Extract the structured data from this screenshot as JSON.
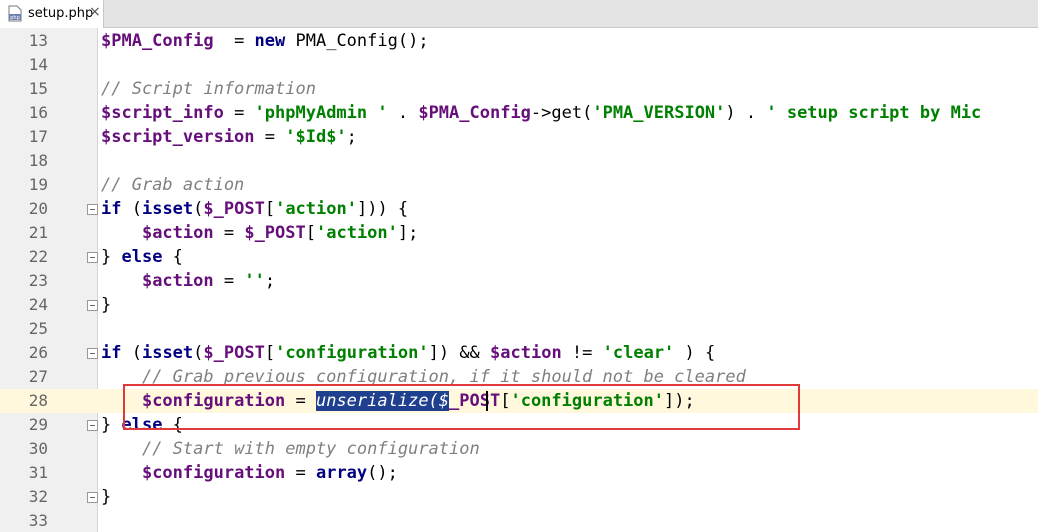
{
  "tab": {
    "filename": "setup.php",
    "close_glyph": "×",
    "icon": "php-file-icon"
  },
  "lines": [
    {
      "n": "13",
      "seg": [
        [
          "var",
          "$PMA_Config"
        ],
        [
          "",
          "  = "
        ],
        [
          "kw",
          "new"
        ],
        [
          "fn",
          " PMA_Config();"
        ]
      ]
    },
    {
      "n": "14",
      "seg": []
    },
    {
      "n": "15",
      "seg": [
        [
          "cmt",
          "// Script information"
        ]
      ]
    },
    {
      "n": "16",
      "seg": [
        [
          "var",
          "$script_info"
        ],
        [
          "",
          " = "
        ],
        [
          "str",
          "'phpMyAdmin '"
        ],
        [
          "",
          " . "
        ],
        [
          "var",
          "$PMA_Config"
        ],
        [
          "",
          "->get("
        ],
        [
          "str",
          "'PMA_VERSION'"
        ],
        [
          "",
          ") . "
        ],
        [
          "str",
          "' setup script by Mic"
        ]
      ]
    },
    {
      "n": "17",
      "seg": [
        [
          "var",
          "$script_version"
        ],
        [
          "",
          " = "
        ],
        [
          "str",
          "'$Id$'"
        ],
        [
          "",
          ";"
        ]
      ]
    },
    {
      "n": "18",
      "seg": []
    },
    {
      "n": "19",
      "seg": [
        [
          "cmt",
          "// Grab action"
        ]
      ]
    },
    {
      "n": "20",
      "seg": [
        [
          "kw",
          "if"
        ],
        [
          "",
          " ("
        ],
        [
          "kw",
          "isset"
        ],
        [
          "",
          "("
        ],
        [
          "var",
          "$_POST"
        ],
        [
          "",
          "["
        ],
        [
          "str",
          "'action'"
        ],
        [
          "",
          "])) {"
        ]
      ]
    },
    {
      "n": "21",
      "seg": [
        [
          "",
          "    "
        ],
        [
          "var",
          "$action"
        ],
        [
          "",
          " = "
        ],
        [
          "var",
          "$_POST"
        ],
        [
          "",
          "["
        ],
        [
          "str",
          "'action'"
        ],
        [
          "",
          "];"
        ]
      ]
    },
    {
      "n": "22",
      "seg": [
        [
          "",
          "} "
        ],
        [
          "kw",
          "else"
        ],
        [
          "",
          " {"
        ]
      ]
    },
    {
      "n": "23",
      "seg": [
        [
          "",
          "    "
        ],
        [
          "var",
          "$action"
        ],
        [
          "",
          " = "
        ],
        [
          "str",
          "''"
        ],
        [
          "",
          ";"
        ]
      ]
    },
    {
      "n": "24",
      "seg": [
        [
          "",
          "}"
        ]
      ]
    },
    {
      "n": "25",
      "seg": []
    },
    {
      "n": "26",
      "seg": [
        [
          "kw",
          "if"
        ],
        [
          "",
          " ("
        ],
        [
          "kw",
          "isset"
        ],
        [
          "",
          "("
        ],
        [
          "var",
          "$_POST"
        ],
        [
          "",
          "["
        ],
        [
          "str",
          "'configuration'"
        ],
        [
          "",
          "]) && "
        ],
        [
          "var",
          "$action"
        ],
        [
          "",
          " != "
        ],
        [
          "str",
          "'clear'"
        ],
        [
          "",
          " ) {"
        ]
      ]
    },
    {
      "n": "27",
      "seg": [
        [
          "",
          "    "
        ],
        [
          "cmt",
          "// Grab previous configuration, if it should not be cleared"
        ]
      ]
    },
    {
      "n": "28",
      "seg": [
        [
          "",
          "    "
        ],
        [
          "var",
          "$configuration"
        ],
        [
          "",
          " = "
        ],
        [
          "sel",
          "unserialize($"
        ],
        [
          "var",
          "_POST"
        ],
        [
          "",
          "["
        ],
        [
          "str",
          "'configuration'"
        ],
        [
          "",
          "]);"
        ]
      ]
    },
    {
      "n": "29",
      "seg": [
        [
          "",
          "} "
        ],
        [
          "kw",
          "else"
        ],
        [
          "",
          " {"
        ]
      ]
    },
    {
      "n": "30",
      "seg": [
        [
          "",
          "    "
        ],
        [
          "cmt",
          "// Start with empty configuration"
        ]
      ]
    },
    {
      "n": "31",
      "seg": [
        [
          "",
          "    "
        ],
        [
          "var",
          "$configuration"
        ],
        [
          "",
          " = "
        ],
        [
          "kw",
          "array"
        ],
        [
          "",
          "();"
        ]
      ]
    },
    {
      "n": "32",
      "seg": [
        [
          "",
          "}"
        ]
      ]
    },
    {
      "n": "33",
      "seg": []
    }
  ],
  "current_line": "28",
  "fold_markers": [
    "20",
    "22",
    "24",
    "26",
    "29",
    "32"
  ],
  "colors": {
    "highlight_box": "#e03a3a",
    "selection": "#1f3f8f"
  }
}
